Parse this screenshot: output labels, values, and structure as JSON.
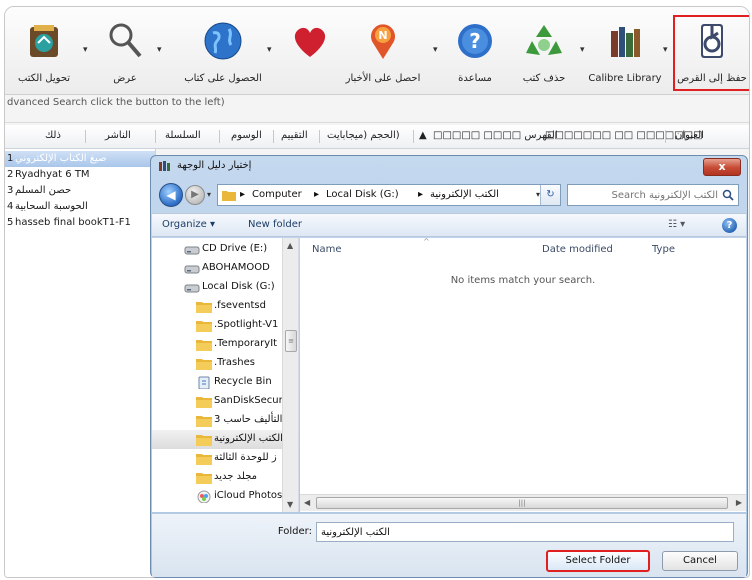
{
  "toolbar": {
    "save_to_disk": "حفظ إلى القرص",
    "calibre_library": "Calibre Library",
    "remove_books": "حذف كتب",
    "help": "مساعدة",
    "fetch_news": "احصل على الأخبار",
    "get_books": "الحصول على كتاب",
    "view": "عرض",
    "convert_books": "تحويل الكتب"
  },
  "search_hint": "dvanced Search click the button to the left)",
  "columns": {
    "title": "العنوان",
    "authors": "□□□□□□□ □□ □□□□□□□",
    "index": "القهرس □□□□ □□□□□",
    "sort_caret": "▲",
    "size": "(الحجم (ميجابايت",
    "rating": "التقييم",
    "tags": "الوسوم",
    "series": "السلسلة",
    "publisher": "الناشر",
    "more": "ذلك"
  },
  "books": [
    {
      "num": "1",
      "title": "صيغ الكتاب الإلكتروني"
    },
    {
      "num": "2",
      "title": "Ryadhyat 6 TM"
    },
    {
      "num": "3",
      "title": "حصن المسلم"
    },
    {
      "num": "4",
      "title": "الحوسبة السحابية"
    },
    {
      "num": "5",
      "title": "hasseb final bookT1-F1"
    }
  ],
  "dialog": {
    "title": "إختيار دليل الوجهة",
    "close": "x",
    "breadcrumb": [
      "Computer",
      "Local Disk (G:)",
      "الكتب الإلكترونية"
    ],
    "search_placeholder": "الكتب الإلكترونية Search",
    "organize": "Organize ▾",
    "new_folder": "New folder",
    "views": "☷ ▾",
    "help": "?",
    "nav_items": [
      {
        "label": "CD Drive (E:)",
        "kind": "drive"
      },
      {
        "label": "ABOHAMOOD",
        "kind": "drive"
      },
      {
        "label": "Local Disk (G:)",
        "kind": "drive"
      },
      {
        "label": ".fseventsd",
        "kind": "folder"
      },
      {
        "label": ".Spotlight-V1",
        "kind": "folder"
      },
      {
        "label": ".TemporaryIt",
        "kind": "folder"
      },
      {
        "label": ".Trashes",
        "kind": "folder"
      },
      {
        "label": "Recycle Bin",
        "kind": "recycle"
      },
      {
        "label": "SanDiskSecur",
        "kind": "folder"
      },
      {
        "label": "التأليف حاسب 3",
        "kind": "folder"
      },
      {
        "label": "الكتب الإلكترونية",
        "kind": "folder",
        "selected": true
      },
      {
        "label": "ز للوحدة الثالثة",
        "kind": "folder"
      },
      {
        "label": "مجلد جديد",
        "kind": "folder"
      },
      {
        "label": "iCloud Photos",
        "kind": "icloud"
      }
    ],
    "file_columns": {
      "name": "Name",
      "date_modified": "Date modified",
      "type": "Type"
    },
    "empty_message": "No items match your search.",
    "folder_label": "Folder:",
    "folder_value": "الكتب الإلكترونية",
    "select_folder": "Select Folder",
    "cancel": "Cancel"
  },
  "colors": {
    "highlight_red": "#e02020",
    "dialog_frame": "#b6cde8",
    "selection_blue": "#a9c6ea",
    "folder_yellow": "#e9b83a",
    "close_red": "#c64a34"
  }
}
